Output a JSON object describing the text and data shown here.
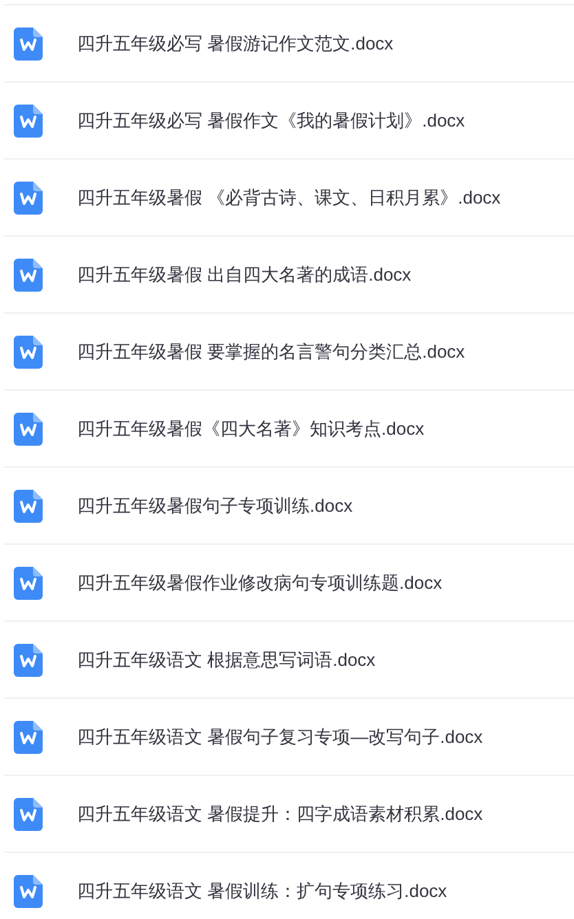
{
  "files": [
    {
      "name": "四升五年级必写 暑假游记作文范文.docx"
    },
    {
      "name": "四升五年级必写 暑假作文《我的暑假计划》.docx"
    },
    {
      "name": "四升五年级暑假 《必背古诗、课文、日积月累》.docx"
    },
    {
      "name": "四升五年级暑假 出自四大名著的成语.docx"
    },
    {
      "name": "四升五年级暑假 要掌握的名言警句分类汇总.docx"
    },
    {
      "name": "四升五年级暑假《四大名著》知识考点.docx"
    },
    {
      "name": "四升五年级暑假句子专项训练.docx"
    },
    {
      "name": "四升五年级暑假作业修改病句专项训练题.docx"
    },
    {
      "name": "四升五年级语文 根据意思写词语.docx"
    },
    {
      "name": "四升五年级语文 暑假句子复习专项—改写句子.docx"
    },
    {
      "name": "四升五年级语文 暑假提升：四字成语素材积累.docx"
    },
    {
      "name": "四升五年级语文 暑假训练：扩句专项练习.docx"
    }
  ]
}
